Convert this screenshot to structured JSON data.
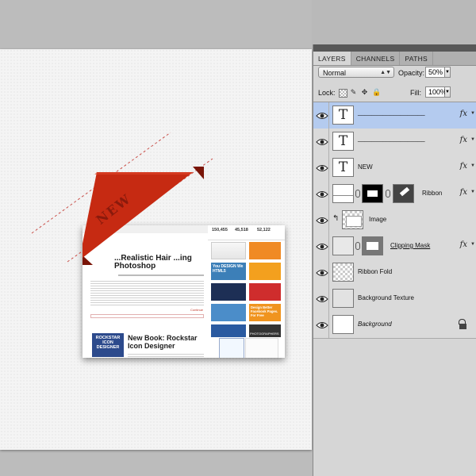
{
  "panel": {
    "tabs": [
      "LAYERS",
      "CHANNELS",
      "PATHS"
    ],
    "blend_mode": "Normal",
    "opacity_label": "Opacity:",
    "opacity_value": "50%",
    "lock_label": "Lock:",
    "fill_label": "Fill:",
    "fill_value": "100%",
    "fx_label": "fx"
  },
  "layers": [
    {
      "name": "___________________",
      "type": "text",
      "fx": true,
      "selected": true
    },
    {
      "name": "___________________",
      "type": "text",
      "fx": true,
      "selected": false
    },
    {
      "name": "NEW",
      "type": "text",
      "fx": true,
      "selected": false
    },
    {
      "name": "Ribbon",
      "type": "shape-masked",
      "fx": true,
      "selected": false
    },
    {
      "name": "Image",
      "type": "image",
      "fx": false,
      "selected": false
    },
    {
      "name": "Clipping Mask",
      "type": "shape",
      "fx": true,
      "selected": false
    },
    {
      "name": "Ribbon Fold",
      "type": "transparent",
      "fx": false,
      "selected": false
    },
    {
      "name": "Background Texture",
      "type": "texture",
      "fx": false,
      "selected": false
    },
    {
      "name": "Background",
      "type": "background",
      "fx": false,
      "selected": false,
      "locked": true
    }
  ],
  "canvas": {
    "ribbon_text": "NEW",
    "article1_title": "...Realistic Hair ...ing Photoshop",
    "article2_title": "New Book: Rockstar Icon Designer",
    "book_cover_text": "ROCKSTAR ICON DESIGNER",
    "stats": [
      "150,455",
      "45,518",
      "52,122"
    ],
    "ad1": "You DESIGN We HTML5",
    "ad2": "Design Better Facebook Pages. For Free",
    "ad3": "PHOTOGRAPHERS",
    "comment_link": "Continue"
  },
  "colors": {
    "ribbon_red": "#c92a14",
    "selection_blue": "#b4cbef",
    "link_red": "#c0392b"
  }
}
